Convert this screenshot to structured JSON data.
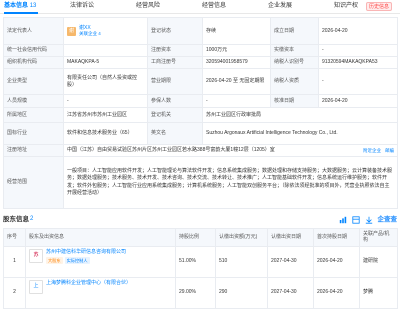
{
  "tabs": [
    {
      "label": "基本信息",
      "count": "13"
    },
    {
      "label": "法律诉讼",
      "count": ""
    },
    {
      "label": "经营风险",
      "count": ""
    },
    {
      "label": "经营信息",
      "count": ""
    },
    {
      "label": "企业发展",
      "count": ""
    },
    {
      "label": "知识产权",
      "count": ""
    }
  ],
  "history_badge": "历史信息",
  "info": {
    "legal_rep_label": "法定代表人",
    "legal_rep_avatar": "谢",
    "legal_rep_name": "谢XX",
    "legal_rep_tag1": "关联企业 4",
    "legal_rep_tag2": "",
    "reg_status_label": "登记状态",
    "reg_status": "存续",
    "est_date_label": "成立日期",
    "est_date": "2026-04-20",
    "credit_code_label": "统一社会信用代码",
    "credit_code": "",
    "reg_capital_label": "注册资本",
    "reg_capital": "1000万元",
    "paid_capital_label": "实缴资本",
    "paid_capital": "-",
    "org_code_label": "组织机构代码",
    "org_code": "MAKAQKPA-5",
    "reg_no_label": "工商注册号",
    "reg_no": "320594001958579",
    "taxpayer_id_label": "纳税人识别号",
    "taxpayer_id": "91320594MAKAQKPA53",
    "company_type_label": "企业类型",
    "company_type": "有限责任公司（自然人投资或控股）",
    "biz_term_label": "营业期限",
    "biz_term": "2026-04-20 至 无固定期限",
    "taxpayer_qual_label": "纳税人资质",
    "taxpayer_qual": "-",
    "staff_label": "人员规模",
    "staff": "-",
    "insured_label": "参保人数",
    "insured": "-",
    "approval_date_label": "核准日期",
    "approval_date": "2026-04-20",
    "region_label": "所属地区",
    "region": "江苏省苏州市苏州工业园区",
    "reg_authority_label": "登记机关",
    "reg_authority": "苏州工业园区行政审批局",
    "industry_label": "国标行业",
    "industry": "软件和信息技术服务业（65）",
    "english_name_label": "英文名",
    "english_name": "Suzhou Argonaux Artificial Intelligence Technology Co., Ltd.",
    "address_label": "注册地址",
    "address": "中国（江苏）自由贸易试验区苏州片区苏州工业园区若水路388号富韵大厦1幢12层（1205）室",
    "address_action1": "附近企业",
    "address_action2": "邮编",
    "scope_label": "经营范围",
    "scope": "一般项目：人工智能应用软件开发；人工智能理论与算法软件开发；信息系统集成服务；数据处理和存储支持服务；大数据服务；云计算装备技术服务；数据处理服务；技术服务、技术开发、技术咨询、技术交流、技术转让、技术推广；人工智能基础软件开发；信息系统运行维护服务；软件开发；软件外包服务；人工智能行业应用系统集成服务；计算机系统服务；人工智能双创服务平台；（除依法须经批准的项目外，凭营业执照依法自主开展经营活动）"
  },
  "shareholders": {
    "title": "股东信息",
    "count": "2",
    "subtitle": "",
    "brand": "企查查",
    "columns": [
      "序号",
      "股东及出资信息",
      "持股比例",
      "认缴出资额(万元)",
      "认缴出资日期",
      "首次持股日期",
      "关联产品/机构"
    ],
    "rows": [
      {
        "index": "1",
        "logo": "苏",
        "name": "苏州中建信科华研信息咨询有限公司",
        "badges": [
          "大股东",
          "实际控制人"
        ],
        "ratio": "51.00%",
        "subscribed": "510",
        "sub_date": "2027-04-30",
        "first_date": "2026-04-20",
        "related": "建研院"
      },
      {
        "index": "2",
        "logo": "上",
        "name": "上海梦腾科企业管理中心（有限合伙）",
        "badges": [],
        "ratio": "29.00%",
        "subscribed": "290",
        "sub_date": "2027-04-30",
        "first_date": "2026-04-20",
        "related": "梦腾"
      }
    ]
  },
  "colors": {
    "accent": "#0084ff",
    "label_bg": "#f5f8fc",
    "border": "#e9ecf1"
  }
}
